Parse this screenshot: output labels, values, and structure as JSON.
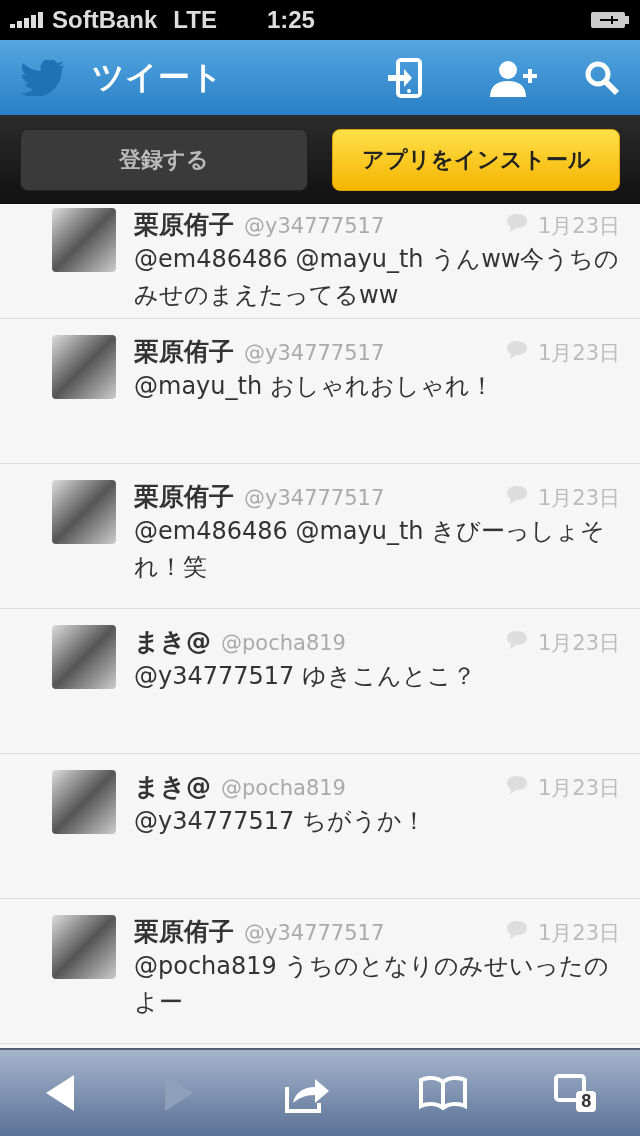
{
  "status_bar": {
    "carrier": "SoftBank",
    "network": "LTE",
    "time": "1:25"
  },
  "nav_bar": {
    "title": "ツイート"
  },
  "action_bar": {
    "buttons": [
      {
        "label": "登録する",
        "kind": "plain"
      },
      {
        "label": "アプリをインストール",
        "kind": "primary"
      }
    ]
  },
  "tweets": [
    {
      "name": "栗原侑子",
      "handle": "@y34777517",
      "date": "1月23日",
      "text": "@em486486 @mayu_th うんww今うちのみせのまえたってるww"
    },
    {
      "name": "栗原侑子",
      "handle": "@y34777517",
      "date": "1月23日",
      "text": "@mayu_th おしゃれおしゃれ！"
    },
    {
      "name": "栗原侑子",
      "handle": "@y34777517",
      "date": "1月23日",
      "text": "@em486486 @mayu_th きびーっしょそれ！笑"
    },
    {
      "name": "まき@",
      "handle": "@pocha819",
      "date": "1月23日",
      "text": "@y34777517 ゆきこんとこ？"
    },
    {
      "name": "まき@",
      "handle": "@pocha819",
      "date": "1月23日",
      "text": "@y34777517 ちがうか！"
    },
    {
      "name": "栗原侑子",
      "handle": "@y34777517",
      "date": "1月23日",
      "text": "@pocha819 うちのとなりのみせいったのよー"
    }
  ],
  "browser_toolbar": {
    "back_disabled": false,
    "forward_disabled": true,
    "tab_count": "8"
  }
}
